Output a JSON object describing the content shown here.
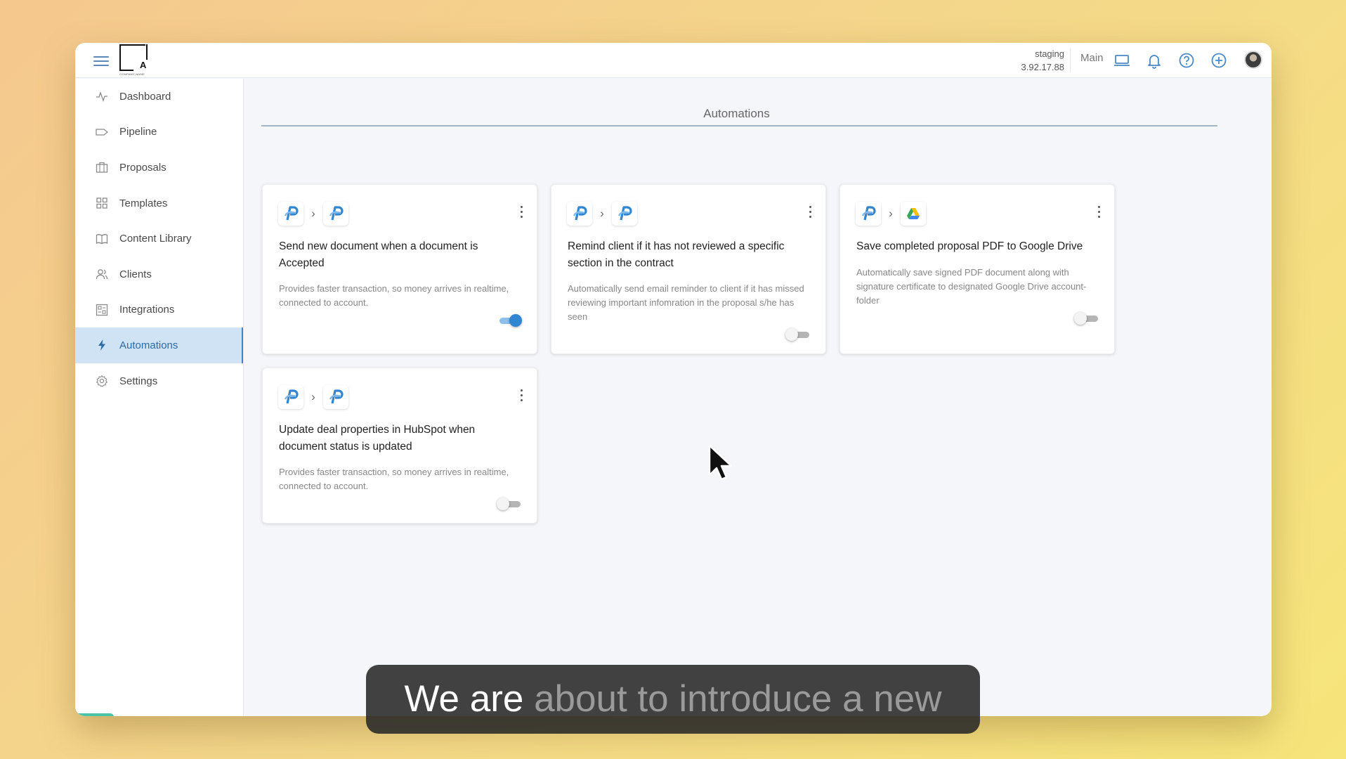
{
  "topbar": {
    "logo_letter": "A",
    "logo_tagline": "COMPANY NAME",
    "env_name": "staging",
    "env_version": "3.92.17.88",
    "workspace": "Main",
    "icons": [
      "monitor-icon",
      "bell-icon",
      "help-icon",
      "add-icon",
      "avatar"
    ]
  },
  "sidebar": {
    "items": [
      {
        "label": "Dashboard",
        "icon": "activity-icon"
      },
      {
        "label": "Pipeline",
        "icon": "tag-icon"
      },
      {
        "label": "Proposals",
        "icon": "briefcase-icon"
      },
      {
        "label": "Templates",
        "icon": "grid-icon"
      },
      {
        "label": "Content Library",
        "icon": "book-icon"
      },
      {
        "label": "Clients",
        "icon": "users-icon"
      },
      {
        "label": "Integrations",
        "icon": "integrations-icon"
      },
      {
        "label": "Automations",
        "icon": "lightning-icon",
        "active": true
      },
      {
        "label": "Settings",
        "icon": "gear-icon"
      }
    ]
  },
  "main": {
    "title": "Automations",
    "cards": [
      {
        "from_app": "proposal-app-icon",
        "to_app": "proposal-app-icon",
        "title": "Send new document when a document is Accepted",
        "description": "Provides faster transaction, so money arrives in realtime, connected to account.",
        "enabled": true
      },
      {
        "from_app": "proposal-app-icon",
        "to_app": "proposal-app-icon",
        "title": "Remind client if it has not reviewed a specific section in the contract",
        "description": "Automatically send email reminder to client if it has missed reviewing important infomration in the proposal s/he has seen",
        "enabled": false
      },
      {
        "from_app": "proposal-app-icon",
        "to_app": "google-drive-icon",
        "title": "Save completed proposal PDF to Google Drive",
        "description": "Automatically save signed PDF document along with signature certificate to designated Google Drive account-folder",
        "enabled": false
      },
      {
        "from_app": "proposal-app-icon",
        "to_app": "proposal-app-icon",
        "title": "Update deal properties in HubSpot when document status is updated",
        "description": "Provides faster transaction, so money arrives in realtime, connected to account.",
        "enabled": false
      }
    ]
  },
  "caption": {
    "spoken": "We are",
    "upcoming": "about to introduce a new"
  },
  "colors": {
    "accent": "#2f86d3",
    "active_nav_bg": "#cfe3f4",
    "caption_bg": "#282828"
  }
}
